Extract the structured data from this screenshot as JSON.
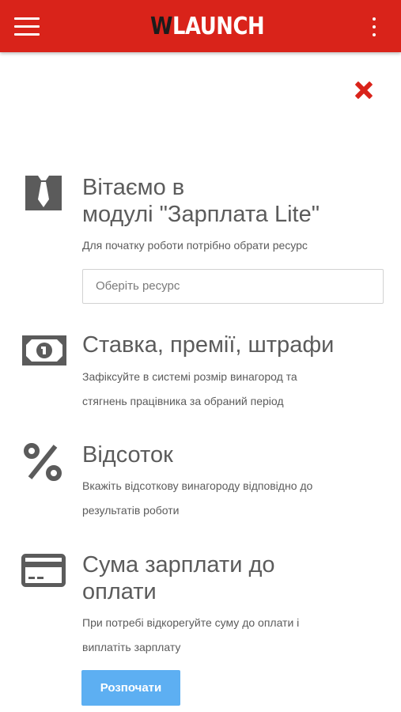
{
  "header": {
    "logo_w": "W",
    "logo_rest": "LAUNCH",
    "menu_icon": "hamburger-icon",
    "more_icon": "kebab-icon",
    "background_color": "#d9231a"
  },
  "close_icon": "close-icon",
  "welcome": {
    "icon": "tie-icon",
    "title_line1": "Вітаємо в",
    "title_line2": "модулі \"Зарплата Lite\"",
    "subtitle": "Для початку роботи потрібно обрати ресурс",
    "resource_placeholder": "Оберіть ресурс"
  },
  "features": [
    {
      "icon": "banknote-icon",
      "title": "Ставка, премії, штрафи",
      "desc_line1": "Зафіксуйте в системі розмір винагород та",
      "desc_line2": "стягнень працівника за обраний період"
    },
    {
      "icon": "percent-icon",
      "title": "Відсоток",
      "desc_line1": "Вкажіть відсоткову винагороду відповідно до",
      "desc_line2": "результатів роботи"
    },
    {
      "icon": "credit-card-icon",
      "title_line1": "Сума зарплати до",
      "title_line2": "оплати",
      "desc_line1": "При потребі відкорегуйте суму до оплати і",
      "desc_line2": "виплатіть зарплату"
    }
  ],
  "start_button": "Розпочати",
  "colors": {
    "accent_red": "#d9231a",
    "button_blue": "#5daff2",
    "text_gray": "#5b5b5b"
  }
}
